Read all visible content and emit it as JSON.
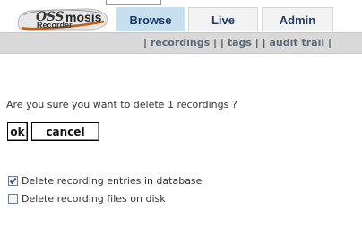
{
  "logo": {
    "text_oss": "OSS",
    "text_mosis": "mosis",
    "subtitle": "Recorder"
  },
  "tabs": [
    {
      "label": "Browse",
      "active": true
    },
    {
      "label": "Live",
      "active": false
    },
    {
      "label": "Admin",
      "active": false
    }
  ],
  "subnav": {
    "sep": "|",
    "items": [
      "recordings",
      "tags",
      "audit trail"
    ]
  },
  "confirm": {
    "question": "Are you sure you want to delete 1 recordings ?",
    "ok_label": "ok",
    "cancel_label": "cancel"
  },
  "options": [
    {
      "label": "Delete recording entries in database",
      "checked": true
    },
    {
      "label": "Delete recording files on disk",
      "checked": false
    }
  ],
  "colors": {
    "active_tab": "#c7e0ef",
    "subnav_bg": "#d9d9d9",
    "tab_text": "#1f3a66"
  }
}
